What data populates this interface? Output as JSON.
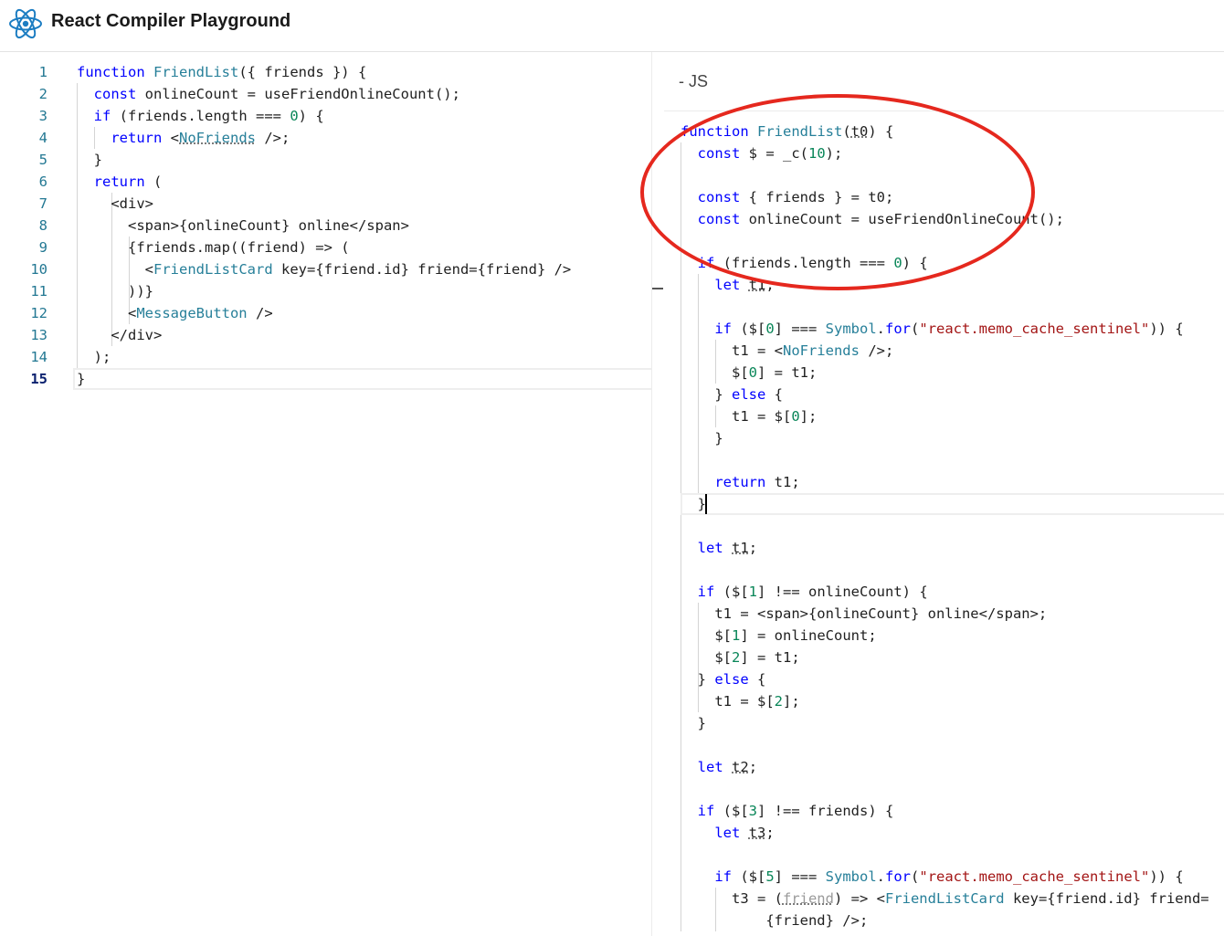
{
  "header": {
    "title": "React Compiler Playground",
    "logo_icon": "react-atom-icon"
  },
  "output_tab": {
    "label": "- JS"
  },
  "left_editor": {
    "active_line": 15,
    "lines": [
      {
        "n": "1",
        "segs": [
          [
            "kw",
            "function"
          ],
          [
            "",
            " "
          ],
          [
            "tag",
            "FriendList"
          ],
          [
            "",
            "({ friends }) {"
          ]
        ]
      },
      {
        "n": "2",
        "segs": [
          [
            "",
            "  "
          ],
          [
            "kw",
            "const"
          ],
          [
            "",
            " onlineCount = useFriendOnlineCount();"
          ]
        ]
      },
      {
        "n": "3",
        "segs": [
          [
            "",
            "  "
          ],
          [
            "kw",
            "if"
          ],
          [
            "",
            " (friends.length === "
          ],
          [
            "num",
            "0"
          ],
          [
            "",
            ") {"
          ]
        ]
      },
      {
        "n": "4",
        "segs": [
          [
            "",
            "    "
          ],
          [
            "kw",
            "return"
          ],
          [
            "",
            " <"
          ],
          [
            "tag sq",
            "NoFriends"
          ],
          [
            "",
            " />;"
          ]
        ]
      },
      {
        "n": "5",
        "segs": [
          [
            "",
            "  }"
          ]
        ]
      },
      {
        "n": "6",
        "segs": [
          [
            "",
            "  "
          ],
          [
            "kw",
            "return"
          ],
          [
            "",
            " ("
          ]
        ]
      },
      {
        "n": "7",
        "segs": [
          [
            "",
            "    <div>"
          ]
        ]
      },
      {
        "n": "8",
        "segs": [
          [
            "",
            "      <span>{onlineCount} online</span>"
          ]
        ]
      },
      {
        "n": "9",
        "segs": [
          [
            "",
            "      {friends.map((friend) => ("
          ]
        ]
      },
      {
        "n": "10",
        "segs": [
          [
            "",
            "        <"
          ],
          [
            "tag",
            "FriendListCard"
          ],
          [
            "",
            " key={friend.id} friend={friend} />"
          ]
        ]
      },
      {
        "n": "11",
        "segs": [
          [
            "",
            "      ))}"
          ]
        ]
      },
      {
        "n": "12",
        "segs": [
          [
            "",
            "      <"
          ],
          [
            "tag",
            "MessageButton"
          ],
          [
            "",
            " />"
          ]
        ]
      },
      {
        "n": "13",
        "segs": [
          [
            "",
            "    </div>"
          ]
        ]
      },
      {
        "n": "14",
        "segs": [
          [
            "",
            "  );"
          ]
        ]
      },
      {
        "n": "15",
        "segs": [
          [
            "",
            "}"
          ]
        ]
      }
    ]
  },
  "right_editor": {
    "lines": [
      {
        "segs": [
          [
            "kw",
            "function"
          ],
          [
            "",
            " "
          ],
          [
            "tag",
            "FriendList"
          ],
          [
            "",
            "("
          ],
          [
            "sq",
            "t0"
          ],
          [
            "",
            ") {"
          ]
        ]
      },
      {
        "segs": [
          [
            "",
            "  "
          ],
          [
            "kw",
            "const"
          ],
          [
            "",
            " $ = _c("
          ],
          [
            "num",
            "10"
          ],
          [
            "",
            ");"
          ]
        ]
      },
      {
        "segs": [
          [
            "",
            ""
          ]
        ]
      },
      {
        "segs": [
          [
            "",
            "  "
          ],
          [
            "kw",
            "const"
          ],
          [
            "",
            " { friends } = t0;"
          ]
        ]
      },
      {
        "segs": [
          [
            "",
            "  "
          ],
          [
            "kw",
            "const"
          ],
          [
            "",
            " onlineCount = useFriendOnlineCount();"
          ]
        ]
      },
      {
        "segs": [
          [
            "",
            ""
          ]
        ]
      },
      {
        "segs": [
          [
            "",
            "  "
          ],
          [
            "kw",
            "if"
          ],
          [
            "",
            " (friends.length === "
          ],
          [
            "num",
            "0"
          ],
          [
            "",
            ") {"
          ]
        ]
      },
      {
        "segs": [
          [
            "",
            "    "
          ],
          [
            "kw",
            "let"
          ],
          [
            "",
            " "
          ],
          [
            "sq",
            "t1"
          ],
          [
            "",
            ";"
          ]
        ]
      },
      {
        "segs": [
          [
            "",
            ""
          ]
        ]
      },
      {
        "segs": [
          [
            "",
            "    "
          ],
          [
            "kw",
            "if"
          ],
          [
            "",
            " ($["
          ],
          [
            "num",
            "0"
          ],
          [
            "",
            "] === "
          ],
          [
            "tag",
            "Symbol"
          ],
          [
            "",
            "."
          ],
          [
            "kw",
            "for"
          ],
          [
            "",
            "("
          ],
          [
            "str",
            "\"react.memo_cache_sentinel\""
          ],
          [
            "",
            ")) {"
          ]
        ]
      },
      {
        "segs": [
          [
            "",
            "      t1 = <"
          ],
          [
            "tag",
            "NoFriends"
          ],
          [
            "",
            " />;"
          ]
        ]
      },
      {
        "segs": [
          [
            "",
            "      $["
          ],
          [
            "num",
            "0"
          ],
          [
            "",
            "] = t1;"
          ]
        ]
      },
      {
        "segs": [
          [
            "",
            "    } "
          ],
          [
            "kw",
            "else"
          ],
          [
            "",
            " {"
          ]
        ]
      },
      {
        "segs": [
          [
            "",
            "      t1 = $["
          ],
          [
            "num",
            "0"
          ],
          [
            "",
            "];"
          ]
        ]
      },
      {
        "segs": [
          [
            "",
            "    }"
          ]
        ]
      },
      {
        "segs": [
          [
            "",
            ""
          ]
        ]
      },
      {
        "segs": [
          [
            "",
            "    "
          ],
          [
            "kw",
            "return"
          ],
          [
            "",
            " t1;"
          ]
        ]
      },
      {
        "segs": [
          [
            "",
            "  }"
          ]
        ]
      },
      {
        "segs": [
          [
            "",
            ""
          ]
        ]
      },
      {
        "segs": [
          [
            "",
            "  "
          ],
          [
            "kw",
            "let"
          ],
          [
            "",
            " "
          ],
          [
            "sq",
            "t1"
          ],
          [
            "",
            ";"
          ]
        ]
      },
      {
        "segs": [
          [
            "",
            ""
          ]
        ]
      },
      {
        "segs": [
          [
            "",
            "  "
          ],
          [
            "kw",
            "if"
          ],
          [
            "",
            " ($["
          ],
          [
            "num",
            "1"
          ],
          [
            "",
            "] !== onlineCount) {"
          ]
        ]
      },
      {
        "segs": [
          [
            "",
            "    t1 = <span>{onlineCount} online</span>;"
          ]
        ]
      },
      {
        "segs": [
          [
            "",
            "    $["
          ],
          [
            "num",
            "1"
          ],
          [
            "",
            "] = onlineCount;"
          ]
        ]
      },
      {
        "segs": [
          [
            "",
            "    $["
          ],
          [
            "num",
            "2"
          ],
          [
            "",
            "] = t1;"
          ]
        ]
      },
      {
        "segs": [
          [
            "",
            "  } "
          ],
          [
            "kw",
            "else"
          ],
          [
            "",
            " {"
          ]
        ]
      },
      {
        "segs": [
          [
            "",
            "    t1 = $["
          ],
          [
            "num",
            "2"
          ],
          [
            "",
            "];"
          ]
        ]
      },
      {
        "segs": [
          [
            "",
            "  }"
          ]
        ]
      },
      {
        "segs": [
          [
            "",
            ""
          ]
        ]
      },
      {
        "segs": [
          [
            "",
            "  "
          ],
          [
            "kw",
            "let"
          ],
          [
            "",
            " "
          ],
          [
            "sq",
            "t2"
          ],
          [
            "",
            ";"
          ]
        ]
      },
      {
        "segs": [
          [
            "",
            ""
          ]
        ]
      },
      {
        "segs": [
          [
            "",
            "  "
          ],
          [
            "kw",
            "if"
          ],
          [
            "",
            " ($["
          ],
          [
            "num",
            "3"
          ],
          [
            "",
            "] !== friends) {"
          ]
        ]
      },
      {
        "segs": [
          [
            "",
            "    "
          ],
          [
            "kw",
            "let"
          ],
          [
            "",
            " "
          ],
          [
            "sq",
            "t3"
          ],
          [
            "",
            ";"
          ]
        ]
      },
      {
        "segs": [
          [
            "",
            ""
          ]
        ]
      },
      {
        "segs": [
          [
            "",
            "    "
          ],
          [
            "kw",
            "if"
          ],
          [
            "",
            " ($["
          ],
          [
            "num",
            "5"
          ],
          [
            "",
            "] === "
          ],
          [
            "tag",
            "Symbol"
          ],
          [
            "",
            "."
          ],
          [
            "kw",
            "for"
          ],
          [
            "",
            "("
          ],
          [
            "str",
            "\"react.memo_cache_sentinel\""
          ],
          [
            "",
            ")) {"
          ]
        ]
      },
      {
        "segs": [
          [
            "",
            "      t3 = ("
          ],
          [
            "dim sq",
            "friend"
          ],
          [
            "",
            ") => <"
          ],
          [
            "tag",
            "FriendListCard"
          ],
          [
            "",
            " key={friend.id} friend="
          ]
        ]
      },
      {
        "segs": [
          [
            "",
            "          {friend} />;"
          ]
        ]
      }
    ]
  }
}
